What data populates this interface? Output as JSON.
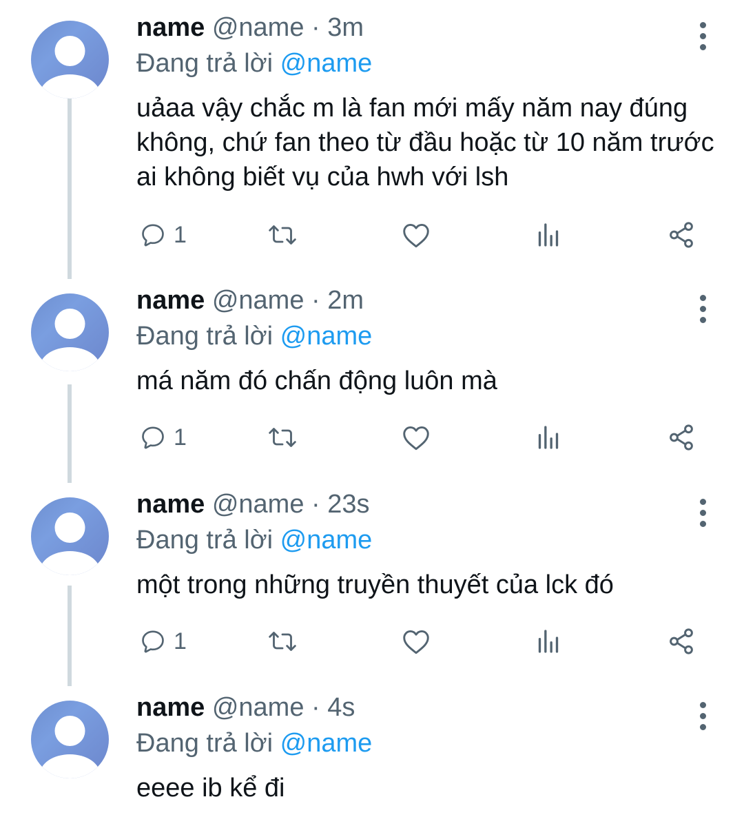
{
  "tweets": [
    {
      "name": "name",
      "handle": "@name",
      "dot": "·",
      "time": "3m",
      "replying_prefix": "Đang trả lời",
      "replying_to": "@name",
      "text": "uảaa vậy chắc m là fan mới mấy năm nay đúng không, chứ fan theo từ đầu hoặc từ 10 năm trước ai không biết vụ của hwh với lsh",
      "reply_count": "1"
    },
    {
      "name": "name",
      "handle": "@name",
      "dot": "·",
      "time": "2m",
      "replying_prefix": "Đang trả lời",
      "replying_to": "@name",
      "text": "má năm đó chấn động luôn mà",
      "reply_count": "1"
    },
    {
      "name": "name",
      "handle": "@name",
      "dot": "·",
      "time": "23s",
      "replying_prefix": "Đang trả lời",
      "replying_to": "@name",
      "text": "một trong những truyền thuyết của lck đó",
      "reply_count": "1"
    },
    {
      "name": "name",
      "handle": "@name",
      "dot": "·",
      "time": "4s",
      "replying_prefix": "Đang trả lời",
      "replying_to": "@name",
      "text": "eeee ib kể đi"
    }
  ],
  "icons": {
    "reply": "reply-icon",
    "retweet": "retweet-icon",
    "like": "heart-icon",
    "views": "views-icon",
    "share": "share-icon",
    "more": "more-vertical-icon"
  },
  "colors": {
    "text": "#0f1419",
    "secondary": "#536471",
    "link": "#1d9bf0",
    "thread_line": "#cfd9de"
  }
}
